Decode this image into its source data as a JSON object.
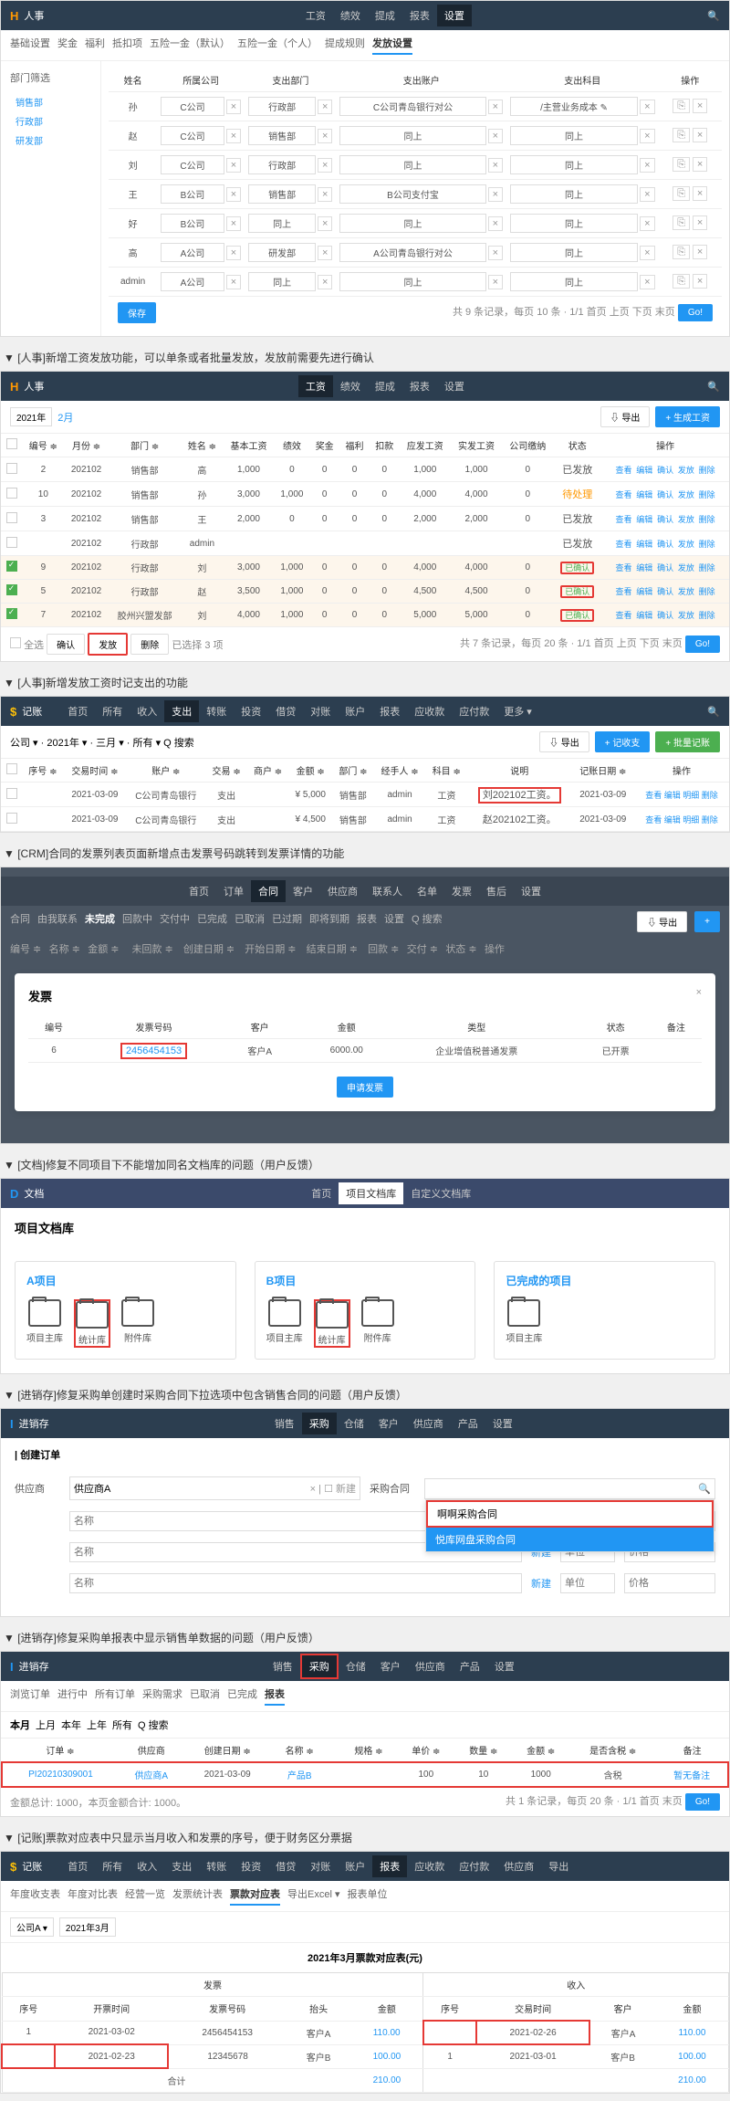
{
  "s1": {
    "title": "人事",
    "navs": [
      "工资",
      "绩效",
      "提成",
      "报表",
      "设置"
    ],
    "subnavs": [
      "基础设置",
      "奖金",
      "福利",
      "抵扣项",
      "五险一金（默认）",
      "五险一金（个人）",
      "提成规则",
      "发放设置"
    ],
    "sidebar_title": "部门筛选",
    "sidebar": [
      "销售部",
      "行政部",
      "研发部"
    ],
    "cols": [
      "姓名",
      "所属公司",
      "支出部门",
      "支出账户",
      "支出科目",
      "操作"
    ],
    "rows": [
      {
        "name": "孙",
        "co": "C公司",
        "dept": "行政部",
        "acct": "C公司青岛银行对公",
        "subj": "/主营业务成本 ✎"
      },
      {
        "name": "赵",
        "co": "C公司",
        "dept": "销售部",
        "acct": "同上",
        "subj": "同上"
      },
      {
        "name": "刘",
        "co": "C公司",
        "dept": "行政部",
        "acct": "同上",
        "subj": "同上"
      },
      {
        "name": "王",
        "co": "B公司",
        "dept": "销售部",
        "acct": "B公司支付宝",
        "subj": "同上"
      },
      {
        "name": "好",
        "co": "B公司",
        "dept": "同上",
        "acct": "同上",
        "subj": "同上"
      },
      {
        "name": "高",
        "co": "A公司",
        "dept": "研发部",
        "acct": "A公司青岛银行对公",
        "subj": "同上"
      },
      {
        "name": "admin",
        "co": "A公司",
        "dept": "同上",
        "acct": "同上",
        "subj": "同上"
      }
    ],
    "save": "保存",
    "pager": "共 9 条记录，每页 10 条 · 1/1  首页 上页 下页 末页",
    "go": "Go!"
  },
  "h1": "▼ [人事]新增工资发放功能，可以单条或者批量发放，发放前需要先进行确认",
  "s2": {
    "title": "人事",
    "navs": [
      "工资",
      "绩效",
      "提成",
      "报表",
      "设置"
    ],
    "year": "2021年",
    "month": "2月",
    "export": "⇩ 导出",
    "gen": "+ 生成工资",
    "cols": [
      "编号 ≑",
      "月份 ≑",
      "部门 ≑",
      "姓名 ≑",
      "基本工资",
      "绩效",
      "奖金",
      "福利",
      "扣款",
      "应发工资",
      "实发工资",
      "公司缴纳",
      "状态",
      "操作"
    ],
    "rows": [
      {
        "ck": false,
        "id": "2",
        "m": "202102",
        "d": "销售部",
        "n": "高",
        "base": "1,000",
        "perf": "0",
        "bonus": "0",
        "wel": "0",
        "ded": "0",
        "yf": "1,000",
        "sf": "1,000",
        "co": "0",
        "st": "已发放",
        "hl": false
      },
      {
        "ck": false,
        "id": "10",
        "m": "202102",
        "d": "销售部",
        "n": "孙",
        "base": "3,000",
        "perf": "1,000",
        "bonus": "0",
        "wel": "0",
        "ded": "0",
        "yf": "4,000",
        "sf": "4,000",
        "co": "0",
        "st": "待处理",
        "hl": false
      },
      {
        "ck": false,
        "id": "3",
        "m": "202102",
        "d": "销售部",
        "n": "王",
        "base": "2,000",
        "perf": "0",
        "bonus": "0",
        "wel": "0",
        "ded": "0",
        "yf": "2,000",
        "sf": "2,000",
        "co": "0",
        "st": "已发放",
        "hl": false
      },
      {
        "ck": false,
        "id": "",
        "m": "202102",
        "d": "行政部",
        "n": "admin",
        "base": "",
        "perf": "",
        "bonus": "",
        "wel": "",
        "ded": "",
        "yf": "",
        "sf": "",
        "co": "",
        "st": "已发放",
        "hl": false
      },
      {
        "ck": true,
        "id": "9",
        "m": "202102",
        "d": "行政部",
        "n": "刘",
        "base": "3,000",
        "perf": "1,000",
        "bonus": "0",
        "wel": "0",
        "ded": "0",
        "yf": "4,000",
        "sf": "4,000",
        "co": "0",
        "st": "已确认",
        "hl": true
      },
      {
        "ck": true,
        "id": "5",
        "m": "202102",
        "d": "行政部",
        "n": "赵",
        "base": "3,500",
        "perf": "1,000",
        "bonus": "0",
        "wel": "0",
        "ded": "0",
        "yf": "4,500",
        "sf": "4,500",
        "co": "0",
        "st": "已确认",
        "hl": true
      },
      {
        "ck": true,
        "id": "7",
        "m": "202102",
        "d": "胶州兴盟发部",
        "n": "刘",
        "base": "4,000",
        "perf": "1,000",
        "bonus": "0",
        "wel": "0",
        "ded": "0",
        "yf": "5,000",
        "sf": "5,000",
        "co": "0",
        "st": "已确认",
        "hl": true
      }
    ],
    "actions": [
      "查看",
      "编辑",
      "确认",
      "发放",
      "删除"
    ],
    "selall": "全选",
    "btns": [
      "确认",
      "发放",
      "删除"
    ],
    "seltext": "已选择 3 项",
    "pager": "共 7 条记录，每页 20 条 · 1/1  首页 上页 下页 末页"
  },
  "h2": "▼ [人事]新增发放工资时记支出的功能",
  "s3": {
    "title": "记账",
    "navs": [
      "首页",
      "所有",
      "收入",
      "支出",
      "转账",
      "投资",
      "借贷",
      "对账",
      "账户",
      "报表",
      "应收款",
      "应付款",
      "更多 ▾"
    ],
    "filter": "公司 ▾ · 2021年 ▾ · 三月 ▾ · 所有 ▾  Q 搜索",
    "btns": [
      "⇩ 导出",
      "+ 记收支",
      "+ 批量记账"
    ],
    "cols": [
      "序号 ≑",
      "交易时间 ≑",
      "账户 ≑",
      "交易 ≑",
      "商户 ≑",
      "金额 ≑",
      "部门 ≑",
      "经手人 ≑",
      "科目 ≑",
      "说明",
      "记账日期 ≑",
      "操作"
    ],
    "rows": [
      {
        "sn": "",
        "dt": "2021-03-09",
        "acct": "C公司青岛银行",
        "tx": "支出",
        "mer": "",
        "amt": "¥ 5,000",
        "dept": "销售部",
        "op": "admin",
        "subj": "工资",
        "note": "刘202102工资。",
        "rd": "2021-03-09",
        "act": "查看 编辑 明细 删除"
      },
      {
        "sn": "",
        "dt": "2021-03-09",
        "acct": "C公司青岛银行",
        "tx": "支出",
        "mer": "",
        "amt": "¥ 4,500",
        "dept": "销售部",
        "op": "admin",
        "subj": "工资",
        "note": "赵202102工资。",
        "rd": "2021-03-09",
        "act": "查看 编辑 明细 删除"
      }
    ]
  },
  "h3": "▼ [CRM]合同的发票列表页面新增点击发票号码跳转到发票详情的功能",
  "s4": {
    "navs": [
      "首页",
      "订单",
      "合同",
      "客户",
      "供应商",
      "联系人",
      "名单",
      "发票",
      "售后",
      "设置"
    ],
    "subnavs": [
      "合同",
      "由我联系",
      "未完成",
      "回款中",
      "交付中",
      "已完成",
      "已取消",
      "已过期",
      "即将到期",
      "报表",
      "设置",
      "Q 搜索"
    ],
    "cols": [
      "编号 ≑",
      "名称 ≑",
      "金额 ≑",
      "未回款 ≑",
      "创建日期 ≑",
      "开始日期 ≑",
      "结束日期 ≑",
      "回款 ≑",
      "交付 ≑",
      "状态 ≑",
      "操作"
    ],
    "export": "⇩ 导出",
    "add": "+",
    "modal_title": "发票",
    "close": "×",
    "mcols": [
      "编号",
      "发票号码",
      "客户",
      "",
      "金额",
      "类型",
      "",
      "状态",
      "备注"
    ],
    "mrow": {
      "id": "6",
      "no": "2456454153",
      "cust": "客户A",
      "amt": "6000.00",
      "type": "企业增值税普通发票",
      "st": "已开票",
      "note": ""
    },
    "apply": "申请发票"
  },
  "h4": "▼ [文档]修复不同项目下不能增加同名文档库的问题（用户反馈）",
  "s5": {
    "logo": "D",
    "title": "文档",
    "navs": [
      "首页",
      "项目文档库",
      "自定义文档库"
    ],
    "pagetitle": "项目文档库",
    "cards": [
      {
        "t": "A项目",
        "folders": [
          "项目主库",
          "统计库",
          "附件库"
        ],
        "hl": 1
      },
      {
        "t": "B项目",
        "folders": [
          "项目主库",
          "统计库",
          "附件库"
        ],
        "hl": 1
      },
      {
        "t": "已完成的项目",
        "folders": [
          "项目主库"
        ],
        "hl": -1
      }
    ]
  },
  "h5": "▼ [进销存]修复采购单创建时采购合同下拉选项中包含销售合同的问题（用户反馈）",
  "s6": {
    "logo": "I",
    "title": "进销存",
    "navs": [
      "销售",
      "采购",
      "仓储",
      "客户",
      "供应商",
      "产品",
      "设置"
    ],
    "formtitle": "| 创建订单",
    "supplier_label": "供应商",
    "supplier": "供应商A",
    "newsup": "☐ 新建",
    "contract_label": "采购合同",
    "name_ph": "名称",
    "new": "新建",
    "unit_ph": "单位",
    "price_ph": "价格",
    "menu": [
      "啊啊采购合同",
      "悦库网盘采购合同"
    ]
  },
  "h6": "▼ [进销存]修复采购单报表中显示销售单数据的问题（用户反馈）",
  "s7": {
    "logo": "I",
    "title": "进销存",
    "navs": [
      "销售",
      "采购",
      "仓储",
      "客户",
      "供应商",
      "产品",
      "设置"
    ],
    "subnavs": [
      "浏览订单",
      "进行中",
      "所有订单",
      "采购需求",
      "已取消",
      "已完成",
      "报表"
    ],
    "tabs": [
      "本月",
      "上月",
      "本年",
      "上年",
      "所有",
      "Q 搜索"
    ],
    "cols": [
      "订单 ≑",
      "供应商",
      "创建日期 ≑",
      "名称 ≑",
      "",
      "规格 ≑",
      "单价 ≑",
      "数量 ≑",
      "金额 ≑",
      "是否含税 ≑",
      "备注"
    ],
    "row": {
      "ord": "PI20210309001",
      "sup": "供应商A",
      "dt": "2021-03-09",
      "name": "产品B",
      "spec": "",
      "price": "100",
      "qty": "10",
      "amt": "1000",
      "tax": "含税",
      "note": "暂无备注"
    },
    "sum": "金额总计: 1000，本页金额合计: 1000。",
    "pager": "共 1 条记录，每页 20 条 · 1/1  首页 末页"
  },
  "h7": "▼ [记账]票款对应表中只显示当月收入和发票的序号，便于财务区分票据",
  "s8": {
    "logo": "$",
    "title": "记账",
    "navs": [
      "首页",
      "所有",
      "收入",
      "支出",
      "转账",
      "投资",
      "借贷",
      "对账",
      "账户",
      "报表",
      "应收款",
      "应付款",
      "供应商",
      "导出"
    ],
    "subnavs": [
      "年度收支表",
      "年度对比表",
      "经营一览",
      "发票统计表",
      "票款对应表",
      "导出Excel ▾",
      "报表单位"
    ],
    "filter": [
      "公司A ▾",
      "2021年3月"
    ],
    "tabletitle": "2021年3月票款对应表(元)",
    "grp": [
      "发票",
      "",
      "收入"
    ],
    "cols": [
      "序号",
      "开票时间",
      "发票号码",
      "抬头",
      "金额",
      "序号",
      "交易时间",
      "客户",
      "金额"
    ],
    "rows": [
      {
        "i1": "1",
        "d1": "2021-03-02",
        "no": "2456454153",
        "tt": "客户A",
        "a1": "110.00",
        "i2": "",
        "d2": "2021-02-26",
        "c": "客户A",
        "a2": "110.00"
      },
      {
        "i1": "",
        "d1": "2021-02-23",
        "no": "12345678",
        "tt": "客户B",
        "a1": "100.00",
        "i2": "1",
        "d2": "2021-03-01",
        "c": "客户B",
        "a2": "100.00"
      }
    ],
    "total_label": "合计",
    "t1": "210.00",
    "t2": "210.00"
  }
}
